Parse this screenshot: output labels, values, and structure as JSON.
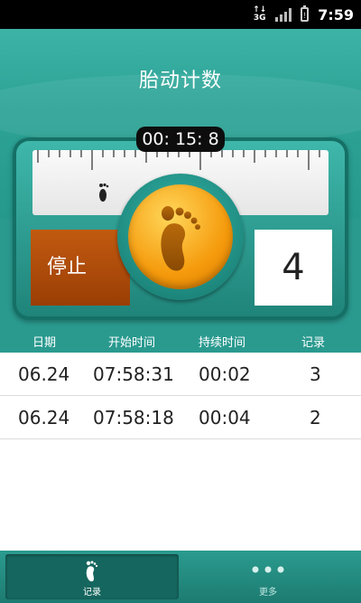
{
  "status_bar": {
    "network": "3G",
    "time": "7:59"
  },
  "header": {
    "title": "胎动计数",
    "timer": "00: 15: 8"
  },
  "counter": {
    "stop_label": "停止",
    "count": "4"
  },
  "table": {
    "headers": [
      "日期",
      "开始时间",
      "持续时间",
      "记录"
    ],
    "rows": [
      {
        "date": "06.24",
        "start": "07:58:31",
        "duration": "00:02",
        "record": "3"
      },
      {
        "date": "06.24",
        "start": "07:58:18",
        "duration": "00:04",
        "record": "2"
      }
    ]
  },
  "bottom_nav": {
    "tabs": [
      {
        "label": "记录",
        "icon": "foot-icon",
        "active": true
      },
      {
        "label": "更多",
        "icon": "more-dots-icon",
        "active": false
      }
    ]
  },
  "colors": {
    "teal": "#2a9a8f",
    "orange": "#f59a0c",
    "stop_brown": "#b04f0c"
  }
}
